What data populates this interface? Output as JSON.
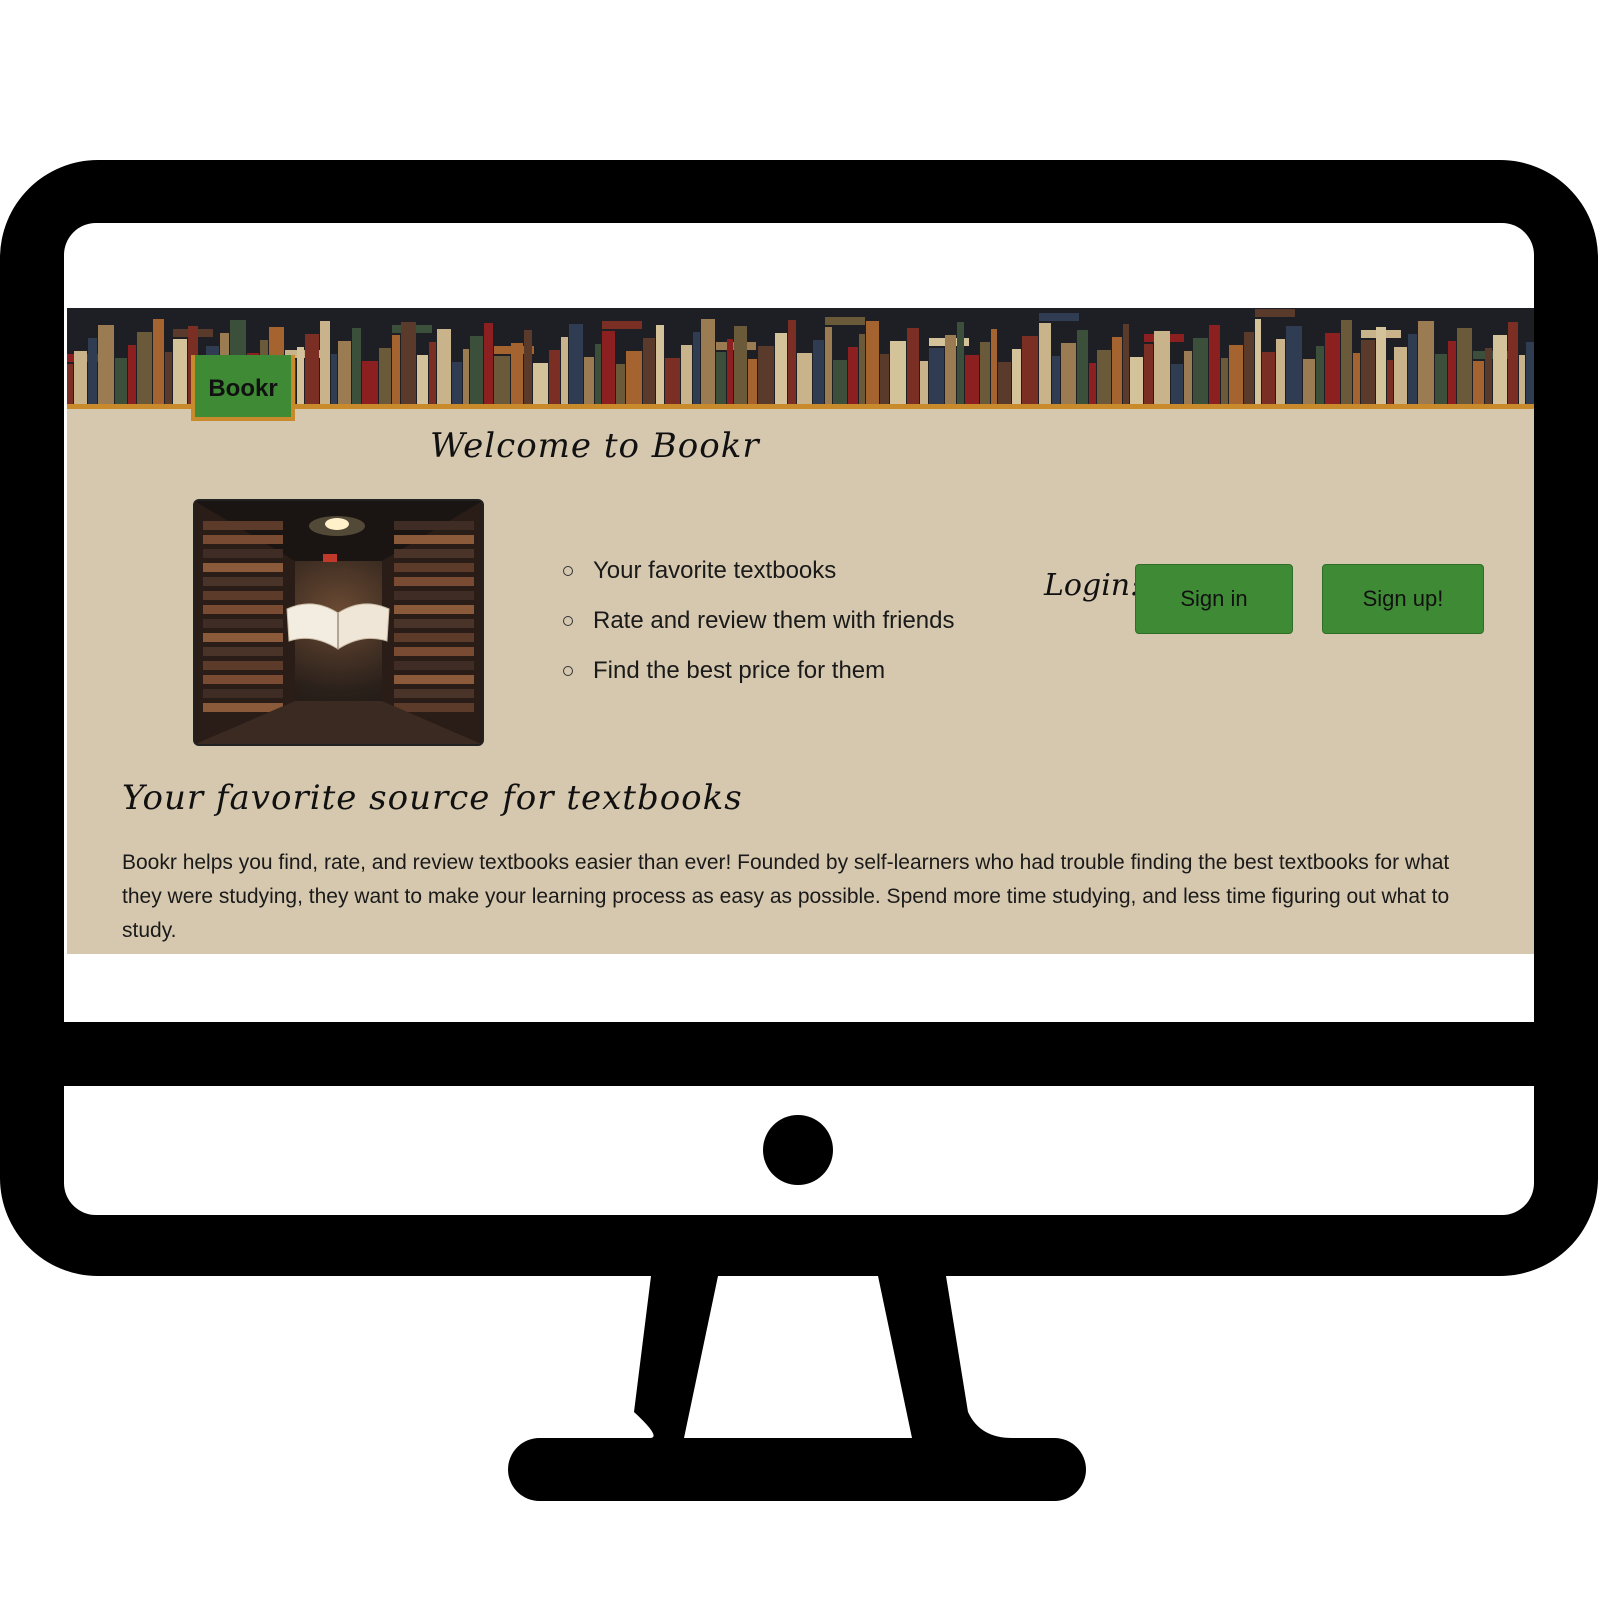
{
  "app": {
    "brand": "Bookr"
  },
  "hero": {
    "welcome_title": "Welcome to Bookr",
    "features": [
      "Your favorite textbooks",
      "Rate and review them with friends",
      "Find the best price for them"
    ]
  },
  "auth": {
    "login_label": "Login:",
    "sign_in_label": "Sign in",
    "sign_up_label": "Sign up!"
  },
  "about": {
    "title": "Your favorite source for textbooks",
    "body": "Bookr helps you find, rate, and review textbooks easier than ever! Founded by self-learners who had trouble finding the best textbooks for what they were studying, they want to make your learning process as easy as possible. Spend more time studying, and less time figuring out what to study."
  },
  "icons": {
    "monitor": "desktop-monitor-icon",
    "bullet": "hollow-circle-bullet"
  },
  "colors": {
    "page_background": "#d6c8af",
    "button_green": "#3f8a34",
    "accent_orange": "#c98a2c",
    "banner_dark": "#1d1f25"
  }
}
